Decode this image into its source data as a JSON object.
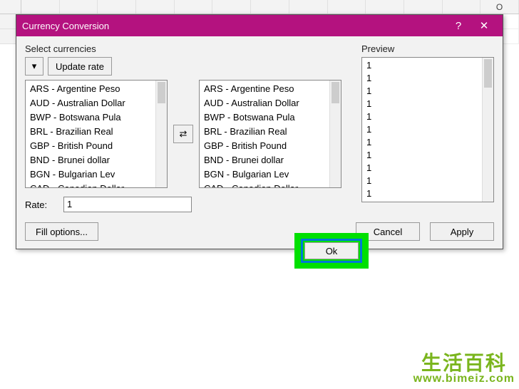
{
  "spreadsheet": {
    "visible_column": "O"
  },
  "dialog": {
    "title": "Currency Conversion",
    "help_symbol": "?",
    "close_symbol": "✕"
  },
  "select_currencies": {
    "label": "Select currencies",
    "update_rate_label": "Update rate",
    "dropdown_glyph": "▾",
    "swap_glyph": "⇄",
    "left_list": [
      "ARS - Argentine Peso",
      "AUD - Australian Dollar",
      "BWP - Botswana Pula",
      "BRL - Brazilian Real",
      "GBP - British Pound",
      "BND - Brunei dollar",
      "BGN - Bulgarian Lev",
      "CAD - Canadian Dollar"
    ],
    "right_list": [
      "ARS - Argentine Peso",
      "AUD - Australian Dollar",
      "BWP - Botswana Pula",
      "BRL - Brazilian Real",
      "GBP - British Pound",
      "BND - Brunei dollar",
      "BGN - Bulgarian Lev",
      "CAD - Canadian Dollar"
    ]
  },
  "rate": {
    "label": "Rate:",
    "value": "1"
  },
  "preview": {
    "label": "Preview",
    "items": [
      "1",
      "1",
      "1",
      "1",
      "1",
      "1",
      "1",
      "1",
      "1",
      "1",
      "1"
    ]
  },
  "buttons": {
    "fill_options": "Fill options...",
    "ok": "Ok",
    "cancel": "Cancel",
    "apply": "Apply"
  },
  "watermark": {
    "cn": "生活百科",
    "url": "www.bimeiz.com"
  }
}
